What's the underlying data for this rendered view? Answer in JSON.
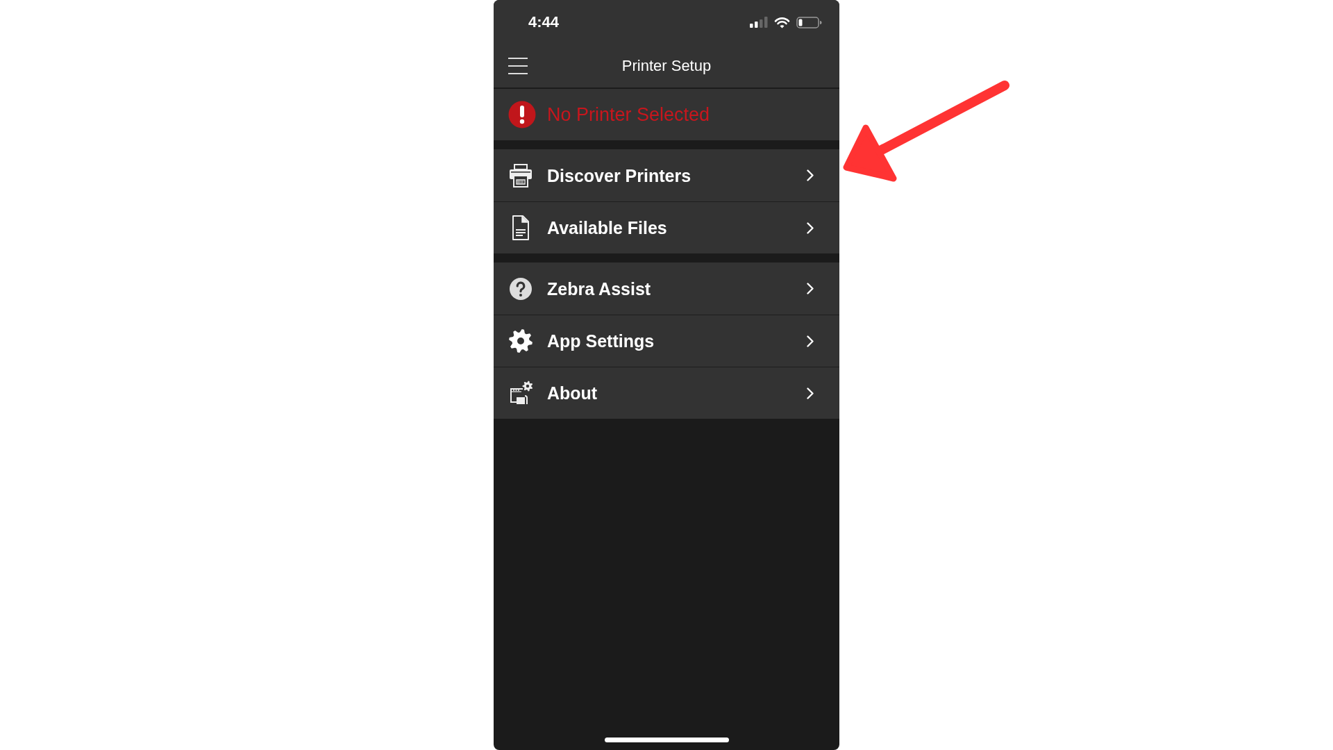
{
  "status_bar": {
    "time": "4:44"
  },
  "header": {
    "title": "Printer Setup"
  },
  "alert": {
    "text": "No Printer Selected"
  },
  "menu_groups": [
    {
      "items": [
        {
          "label": "Discover Printers",
          "kind": "printer"
        },
        {
          "label": "Available Files",
          "kind": "file"
        }
      ]
    },
    {
      "items": [
        {
          "label": "Zebra Assist",
          "kind": "help"
        },
        {
          "label": "App Settings",
          "kind": "settings"
        },
        {
          "label": "About",
          "kind": "about"
        }
      ]
    }
  ]
}
